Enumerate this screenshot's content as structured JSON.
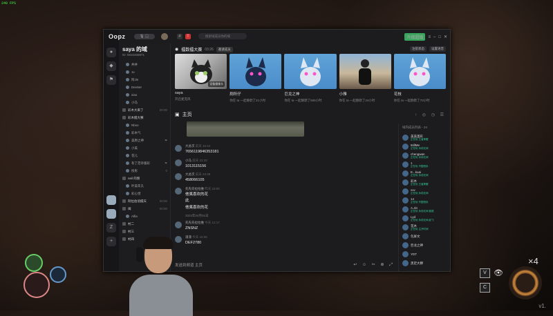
{
  "overlay": {
    "fps": "240 FPS"
  },
  "app": {
    "logo": "Oopz",
    "voice_pill": "🎙 🎧",
    "search_placeholder": "搜索域成员你的域",
    "update_label": "升级超级"
  },
  "server": {
    "name": "saya 的域",
    "id": "ID: 5910468871"
  },
  "channels": [
    {
      "label": "井井",
      "type": "user",
      "count": ""
    },
    {
      "label": "1v",
      "type": "user",
      "count": ""
    },
    {
      "label": "阿Jin",
      "type": "user",
      "count": ""
    },
    {
      "label": "DevSer",
      "type": "user",
      "count": ""
    },
    {
      "label": "xiao",
      "type": "user",
      "count": ""
    },
    {
      "label": "小马",
      "type": "user",
      "count": ""
    },
    {
      "label": "彩木大来了",
      "type": "header",
      "count": "00:00"
    },
    {
      "label": "彩木擂大赛",
      "type": "header",
      "count": ""
    },
    {
      "label": "Nbxo",
      "type": "user",
      "count": ""
    },
    {
      "label": "彩木气",
      "type": "user",
      "count": ""
    },
    {
      "label": "美原之神",
      "type": "user",
      "count": "❤"
    },
    {
      "label": "小美",
      "type": "user",
      "count": ""
    },
    {
      "label": "花儿",
      "type": "user",
      "count": ""
    },
    {
      "label": "有了范幸版彩",
      "type": "user",
      "count": "❤"
    },
    {
      "label": "彤彤",
      "type": "user",
      "count": "0"
    },
    {
      "label": "neil 的频",
      "type": "header",
      "count": ""
    },
    {
      "label": "叶美年久",
      "type": "user",
      "count": ""
    },
    {
      "label": "彩心觉",
      "type": "user",
      "count": ""
    },
    {
      "label": "阿拉伯语擂天",
      "type": "header",
      "count": "00:00"
    },
    {
      "label": "闽",
      "type": "header",
      "count": "00:00"
    },
    {
      "label": "Alfia",
      "type": "user",
      "count": ""
    },
    {
      "label": "村二",
      "type": "header",
      "count": ""
    },
    {
      "label": "村三",
      "type": "header",
      "count": ""
    },
    {
      "label": "村四",
      "type": "header",
      "count": ""
    }
  ],
  "stage": {
    "title": "擂数擂大赛",
    "time": "03:26",
    "btn": "邀请成员",
    "ctl1": "注航状态",
    "ctl2": "设置语音"
  },
  "tiles": [
    {
      "name": "saya",
      "sub": "开启麦克风",
      "kind": "cat",
      "cam": "设备摄像头"
    },
    {
      "name": "厕所仔",
      "sub": "你在 ta 一起静默了21小时",
      "kind": "blue",
      "cam": ""
    },
    {
      "name": "巨龙之神",
      "sub": "你在 ta 一起静默了555小时",
      "kind": "blue",
      "cam": ""
    },
    {
      "name": "小雅",
      "sub": "你在 ta 一起静默了24小时",
      "kind": "city",
      "cam": ""
    },
    {
      "name": "花枝",
      "sub": "你在 ta 一起静默了70小时",
      "kind": "blue",
      "cam": ""
    }
  ],
  "chat": {
    "title": "主页",
    "tools": "↑ ◎ ◷ ☰",
    "composer_placeholder": "发送到频道 主页",
    "composer_icons": "↩ ☺ ✂ ⊕ ⤢"
  },
  "messages": [
    {
      "user": "大此次",
      "time": "前天 15:44",
      "lines": [
        "7656119846353181"
      ]
    },
    {
      "user": "小马",
      "time": "前天 23:33",
      "lines": [
        "1013115156"
      ]
    },
    {
      "user": "大此次",
      "time": "前天 23:38",
      "lines": [
        "458066105"
      ]
    },
    {
      "user": "先先先拉拉维",
      "time": "昨天 23:00",
      "lines": [
        "他夷喜欢的花",
        "此",
        "他夷喜欢的花"
      ]
    },
    {
      "user": "先先先拉拉维",
      "time": "今天 12:17",
      "lines": [
        "ZNSNZ"
      ]
    },
    {
      "user": "潇潇",
      "time": "今天 15:06",
      "lines": [
        "DEF2780"
      ]
    }
  ],
  "date_divider": "2024年04月01日",
  "members": {
    "header": "域内成员列表 - 24",
    "list": [
      {
        "name": "美美蛋彩",
        "status": "正在玩 王者荣耀"
      },
      {
        "name": "5tillMe",
        "status": "正在玩 永劫无间"
      },
      {
        "name": "chengwan",
        "status": "正在玩 永劫无间"
      },
      {
        "name": "1",
        "status": "正在玩 不围恒永"
      },
      {
        "name": "E...kuai",
        "status": "正在玩 永劫无间"
      },
      {
        "name": "彩木",
        "status": "正在玩 王者荣耀"
      },
      {
        "name": "vvv",
        "status": "正在玩 永劫无间"
      },
      {
        "name": "14",
        "status": "正在玩 不围恒永"
      },
      {
        "name": "A.Jin",
        "status": "正在玩 永劫无间 能爬"
      },
      {
        "name": "Lyd",
        "status": "正在玩 永劫无间 起飞"
      },
      {
        "name": "花木",
        "status": "正在玩 主开时间"
      },
      {
        "name": "包屏文",
        "status": ""
      },
      {
        "name": "巨龙之神",
        "status": ""
      },
      {
        "name": "YDT",
        "status": ""
      },
      {
        "name": "黑足大穆",
        "status": ""
      }
    ]
  },
  "hud": {
    "skill_v": "V",
    "skill_c": "C",
    "stack": "×4",
    "version": "v1."
  }
}
